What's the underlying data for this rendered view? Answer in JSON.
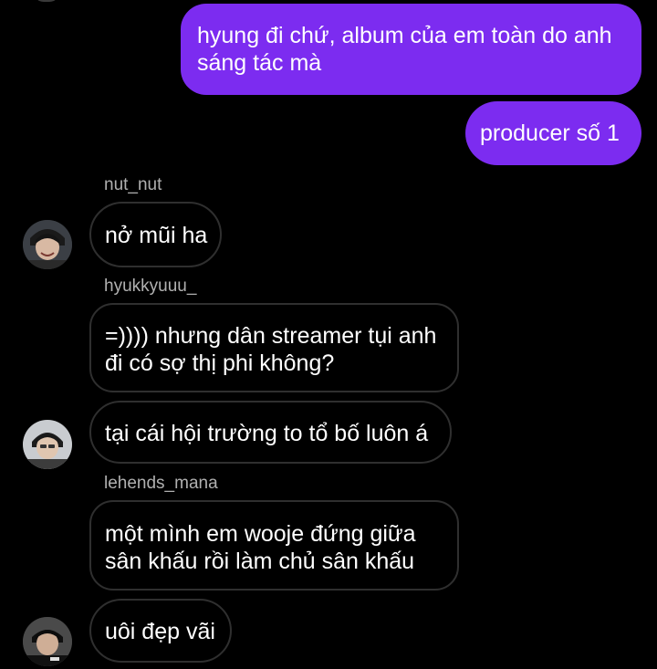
{
  "messages_outgoing": [
    {
      "lines": [
        "hyung đi chứ, album của em toàn do anh",
        "sáng tác mà"
      ]
    },
    {
      "lines": [
        "producer số 1"
      ]
    }
  ],
  "groups": [
    {
      "username": "nut_nut",
      "messages": [
        {
          "lines": [
            "nở mũi ha"
          ]
        }
      ]
    },
    {
      "username": "hyukkyuuu_",
      "messages": [
        {
          "lines": [
            "=)))) nhưng dân streamer tụi anh",
            "đi có sợ thị phi không?"
          ]
        },
        {
          "lines": [
            "tại cái hội trường to tổ bố luôn á"
          ]
        }
      ]
    },
    {
      "username": "lehends_mana",
      "messages": [
        {
          "lines": [
            "một mình em wooje đứng giữa",
            "sân khấu rồi làm chủ sân khấu"
          ]
        },
        {
          "lines": [
            "uôi đẹp vãi"
          ]
        }
      ]
    }
  ],
  "colors": {
    "background": "#000000",
    "outgoing_bubble": "#7c2cf0",
    "incoming_border": "#2f2f2f",
    "username_text": "#b0b0b0"
  },
  "icons": [
    "avatar-nut-nut",
    "avatar-hyukkyuuu",
    "avatar-lehends-mana"
  ]
}
